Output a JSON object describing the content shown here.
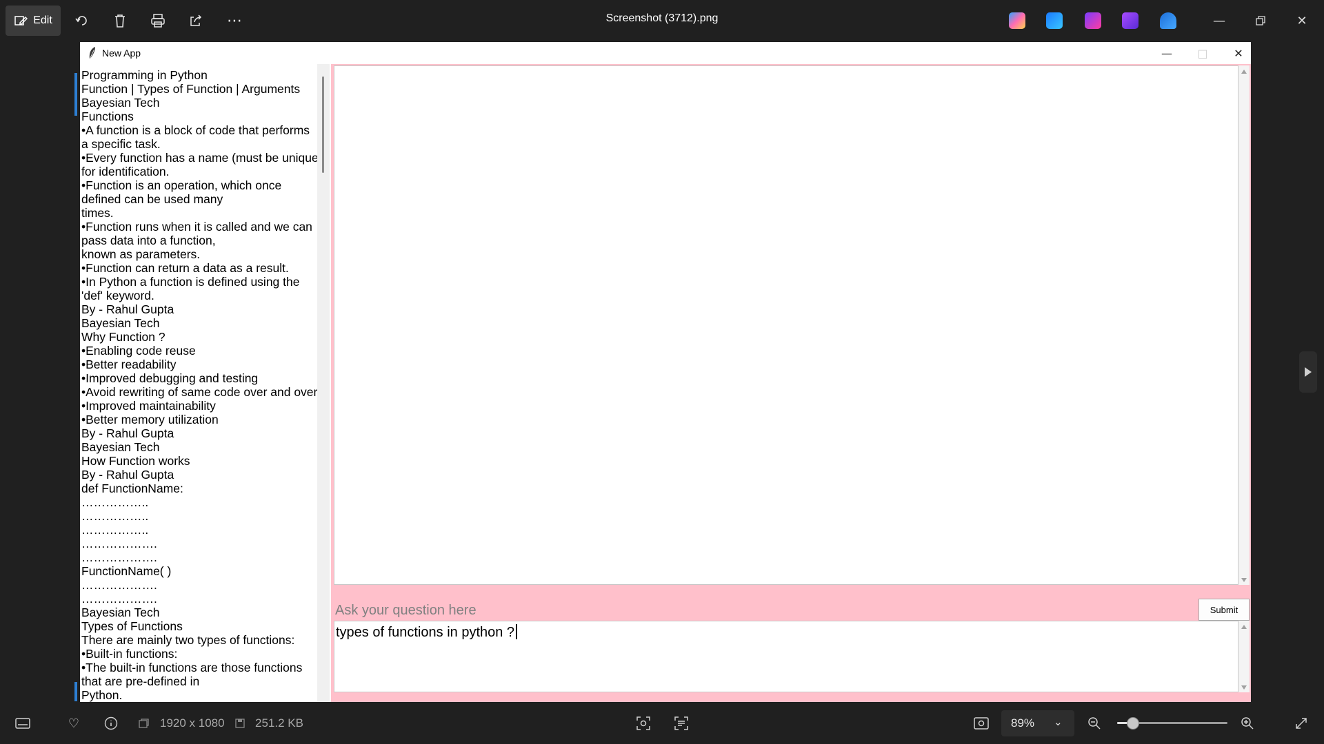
{
  "viewer": {
    "title": "Screenshot (3712).png",
    "edit_label": "Edit",
    "toolbar_icons": [
      "rotate-icon",
      "delete-icon",
      "print-icon",
      "share-icon",
      "more-icon"
    ],
    "app_icons": [
      "copilot-icon",
      "designer-icon",
      "clipchamp-icon",
      "video-editor-icon",
      "onedrive-icon"
    ]
  },
  "app": {
    "title": "New App",
    "left_lines": [
      "Programming in Python",
      "Function | Types of Function | Arguments",
      "Bayesian Tech",
      "Functions",
      "•A function is a block of code that performs",
      "a specific task.",
      "•Every function has a name (must be unique)",
      "for identification.",
      "•Function is an operation, which once",
      "defined can be used many",
      "times.",
      "•Function runs when it is called and we can",
      "pass data into a function,",
      "known as parameters.",
      "•Function can return a data as a result.",
      "•In Python a function is defined using the",
      "'def' keyword.",
      "By - Rahul Gupta",
      "Bayesian Tech",
      "Why Function ?",
      "•Enabling code reuse",
      "•Better readability",
      "•Improved debugging and testing",
      "•Avoid rewriting of same code over and over",
      "•Improved maintainability",
      "•Better memory utilization",
      "By - Rahul Gupta",
      "Bayesian Tech",
      "How Function works",
      "By - Rahul Gupta",
      "def FunctionName:",
      "……………..",
      "……………..",
      "……………..",
      "……………….",
      "……………….",
      "FunctionName( )",
      "……………….",
      "……………….",
      "Bayesian Tech",
      "Types of Functions",
      "There are mainly two types of functions:",
      "•Built-in functions:",
      "•The built-in functions are those functions",
      "that are pre-defined in",
      "Python."
    ],
    "ask_label": "Ask your question here",
    "submit_label": "Submit",
    "question_value": "types of functions in python ?"
  },
  "status": {
    "dimensions": "1920 x 1080",
    "file_size": "251.2 KB",
    "zoom": "89%",
    "zoom_fraction": 0.14
  },
  "colors": {
    "accent": "#2d7fd3",
    "pink": "#ffc0cb",
    "viewer_bg": "#202020"
  }
}
